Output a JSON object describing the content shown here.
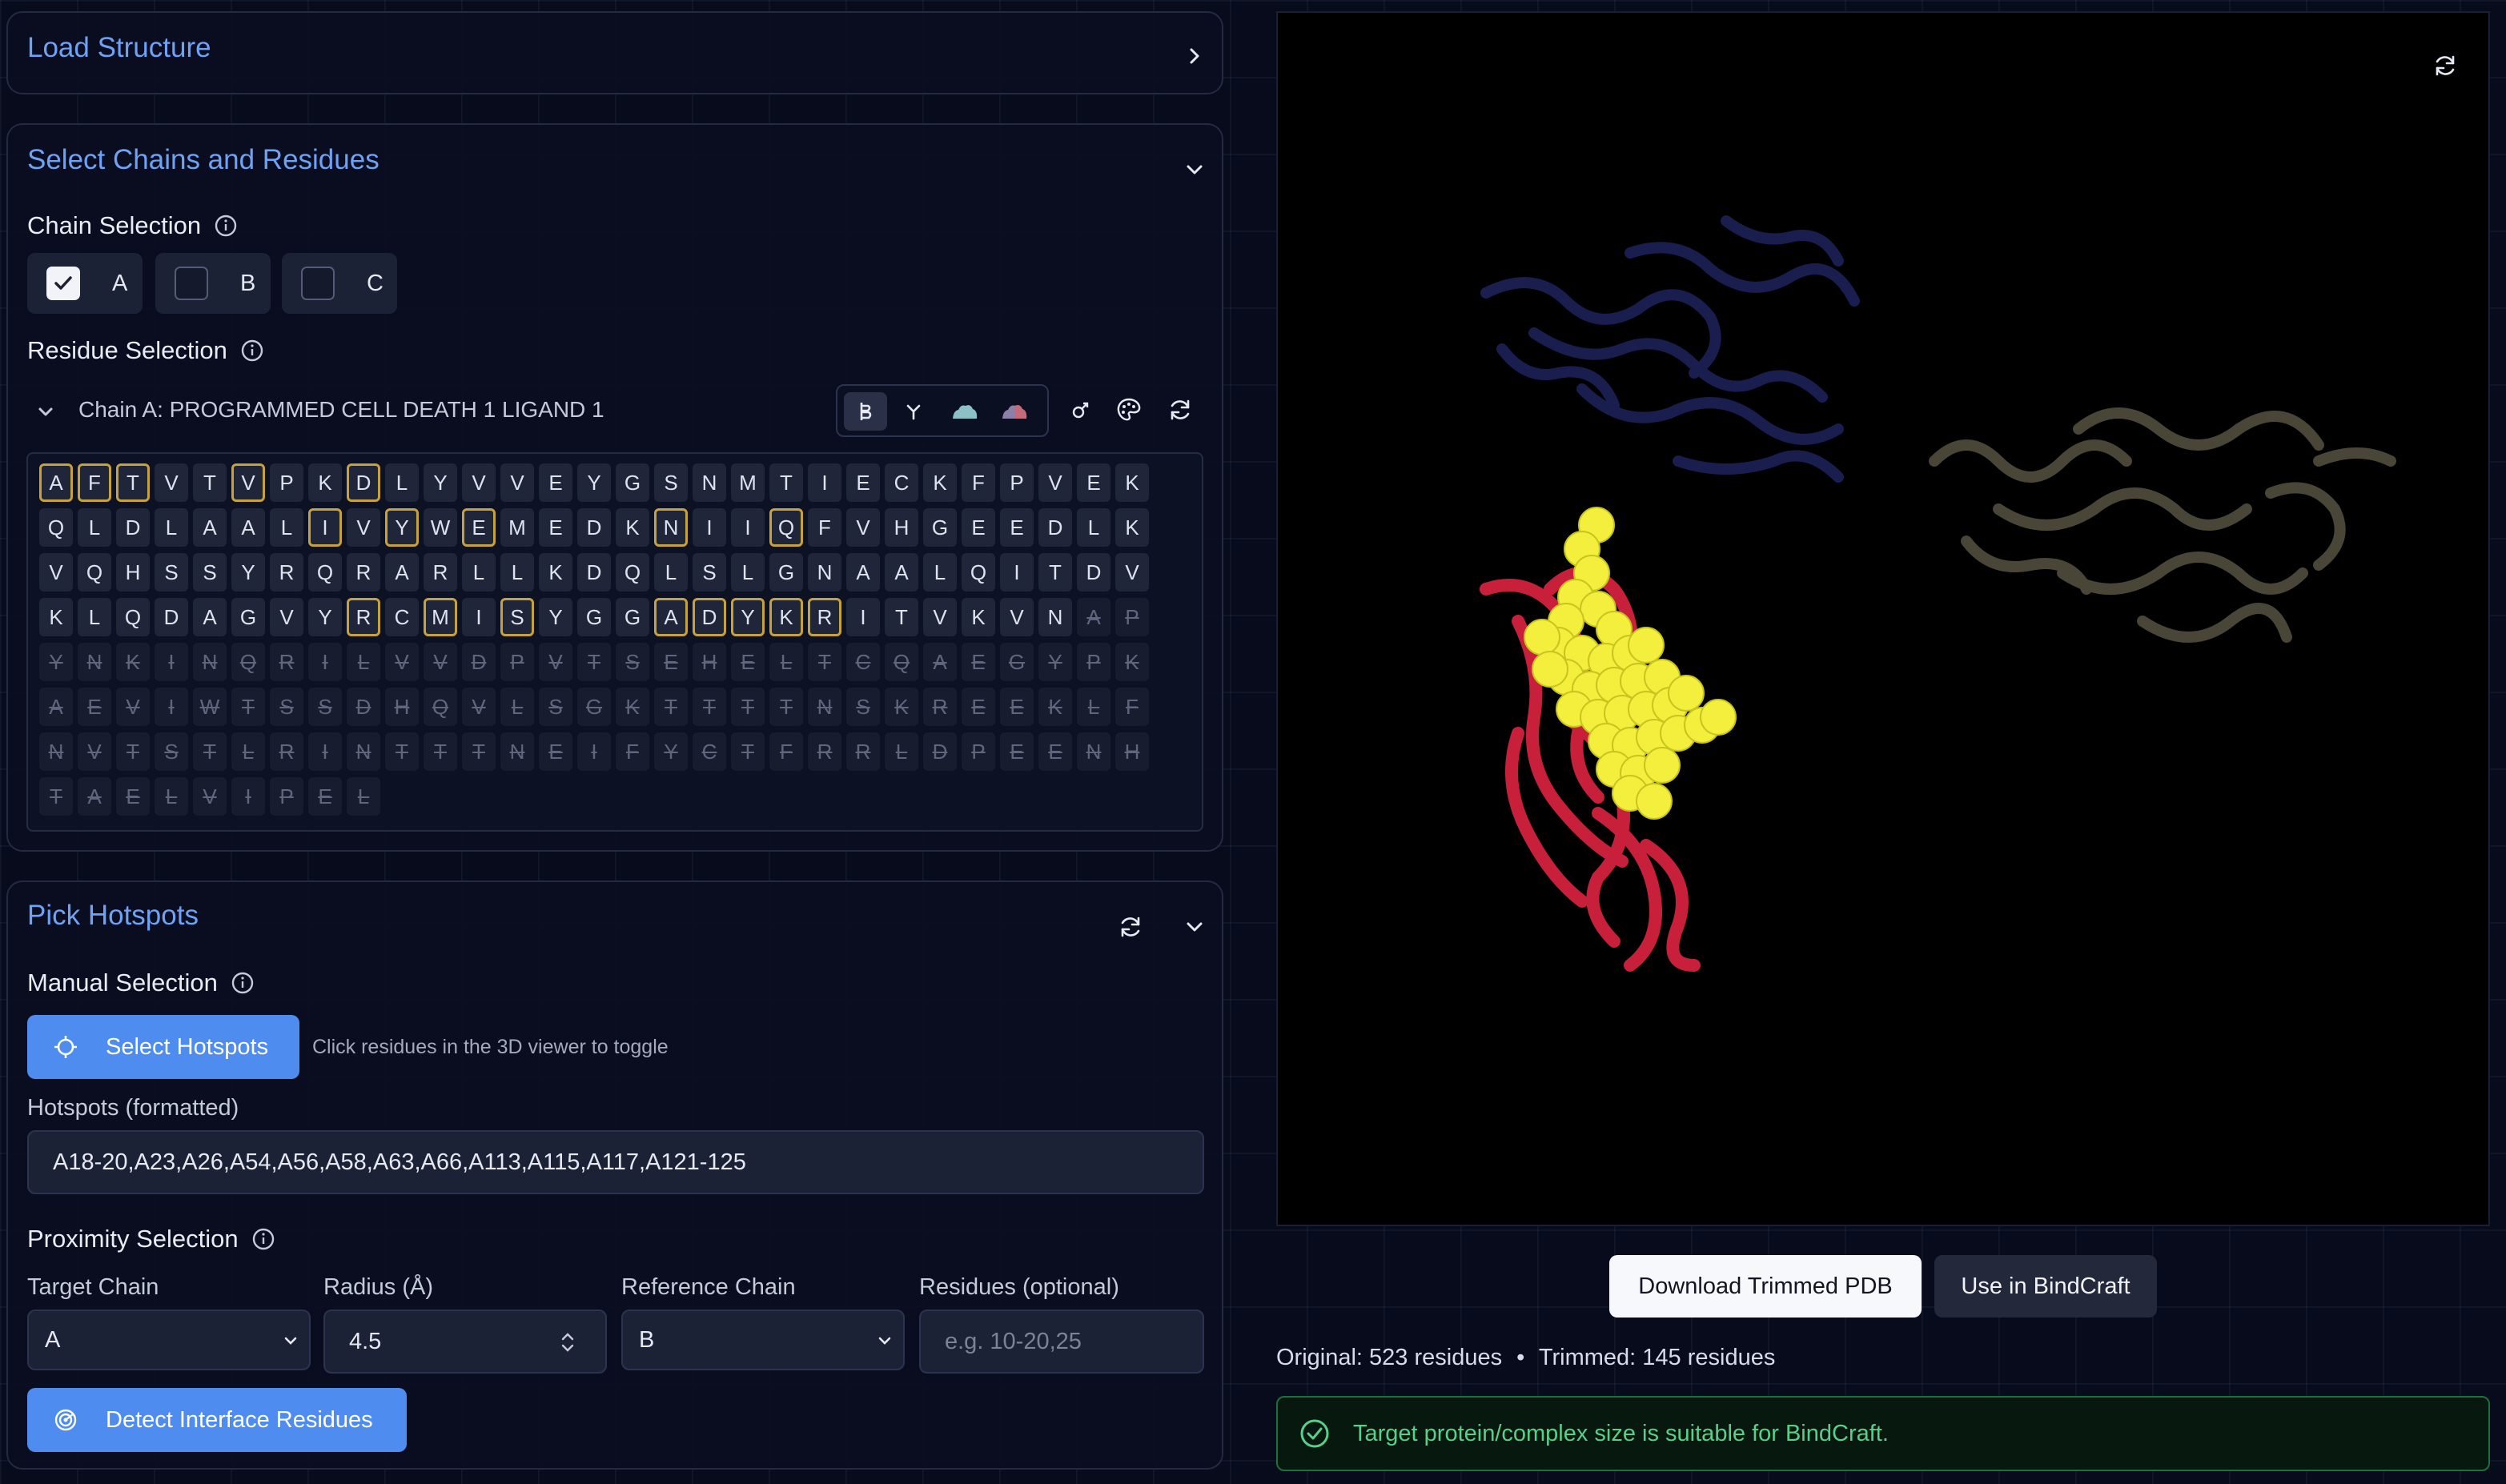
{
  "load_panel": {
    "title": "Load Structure"
  },
  "select_panel": {
    "title": "Select Chains and Residues",
    "chain_selection_label": "Chain Selection",
    "chains": [
      {
        "label": "A",
        "checked": true
      },
      {
        "label": "B",
        "checked": false
      },
      {
        "label": "C",
        "checked": false
      }
    ],
    "residue_selection_label": "Residue Selection",
    "chain_header": "Chain A: PROGRAMMED CELL DEATH 1 LIGAND 1",
    "toolbar_icons": [
      "ligand-icon",
      "branch-icon",
      "surface-icon",
      "surface-colored-icon"
    ],
    "sequence_rows": [
      {
        "letters": "AFTVTVPKDLYVVEYGSNMTIECKFPVEK",
        "selected": [
          0,
          1,
          2,
          5,
          8
        ],
        "dim": []
      },
      {
        "letters": "QLDLAALIVYWEMEDKNIIQFVHGEEDLK",
        "selected": [
          7,
          9,
          11,
          16,
          19
        ],
        "dim": []
      },
      {
        "letters": "VQHSSYRQRARLLKDQLSLGNAALQITDV",
        "selected": [],
        "dim": []
      },
      {
        "letters": "KLQDAGVYRCMISYGGADYKRITVKVNAP",
        "selected": [
          8,
          10,
          12,
          16,
          17,
          18,
          19,
          20
        ],
        "dim": [
          27,
          28
        ]
      },
      {
        "letters": "YNKINQRILVVDPVTSEHELTCQAEGYPK",
        "selected": [],
        "dim": "all"
      },
      {
        "letters": "AEVIWTSSDHQVLSGKTTTTNSKREEKLF",
        "selected": [],
        "dim": "all"
      },
      {
        "letters": "NVTSTLRINTTTNEIFYCTFRRLDPEENH",
        "selected": [],
        "dim": "all"
      },
      {
        "letters": "TAELVIPEL",
        "selected": [],
        "dim": "all"
      }
    ]
  },
  "hotspot_panel": {
    "title": "Pick Hotspots",
    "manual_label": "Manual Selection",
    "select_button": "Select Hotspots",
    "hint": "Click residues in the 3D viewer to toggle",
    "formatted_label": "Hotspots (formatted)",
    "formatted_value": "A18-20,A23,A26,A54,A56,A58,A63,A66,A113,A115,A117,A121-125",
    "proximity_label": "Proximity Selection",
    "target_chain_label": "Target Chain",
    "target_chain_value": "A",
    "radius_label": "Radius (Å)",
    "radius_value": "4.5",
    "reference_chain_label": "Reference Chain",
    "reference_chain_value": "B",
    "residues_label": "Residues (optional)",
    "residues_placeholder": "e.g. 10-20,25",
    "detect_button": "Detect Interface Residues"
  },
  "viewer": {
    "download_button": "Download Trimmed PDB",
    "bindcraft_button": "Use in BindCraft",
    "original_text": "Original: 523 residues",
    "separator": "•",
    "trimmed_text": "Trimmed: 145 residues",
    "success_message": "Target protein/complex size is suitable for BindCraft."
  },
  "colors": {
    "accent": "#4e8cf0",
    "title_blue": "#6ea2f5",
    "hotspot_outline": "#c7a23a",
    "chain_a": "#c8203a",
    "chain_b": "#1d2258",
    "chain_c": "#4e4a3a",
    "hotspot_spheres": "#f3ef3c",
    "success": "#57d08a"
  }
}
